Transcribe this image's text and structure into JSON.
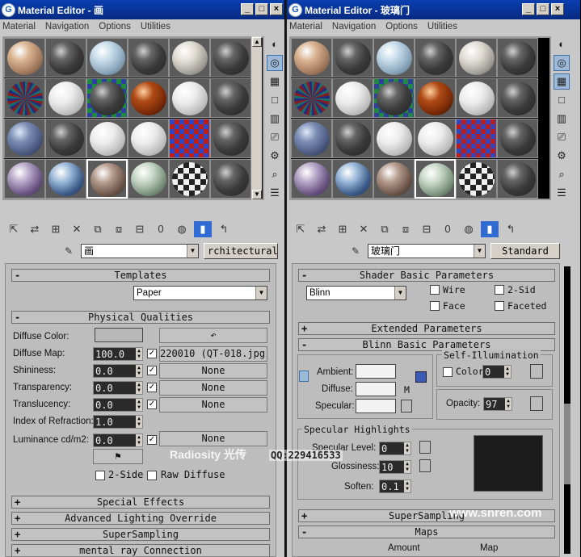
{
  "left_window": {
    "title": "Material Editor - 画",
    "menu": [
      "Material",
      "Navigation",
      "Options",
      "Utilities"
    ],
    "material_name": "画",
    "material_type": "rchitectural",
    "rollouts": {
      "templates": "Templates",
      "template_value": "Paper",
      "physical": "Physical Qualities",
      "special": "Special Effects",
      "advanced": "Advanced Lighting Override",
      "supersampling": "SuperSampling",
      "mentalray": "mental ray Connection"
    },
    "params": [
      {
        "label": "Diffuse Color:",
        "value": "",
        "map": ""
      },
      {
        "label": "Diffuse Map:",
        "value": "100.0",
        "map": "220010 (QT-018.jpg)"
      },
      {
        "label": "Shininess:",
        "value": "0.0",
        "map": "None"
      },
      {
        "label": "Transparency:",
        "value": "0.0",
        "map": "None"
      },
      {
        "label": "Translucency:",
        "value": "0.0",
        "map": "None"
      },
      {
        "label": "Index of Refraction:",
        "value": "1.0",
        "map": ""
      },
      {
        "label": "Luminance cd/m2:",
        "value": "0.0",
        "map": "None"
      }
    ],
    "two_side": "2-Side",
    "raw_diffuse": "Raw Diffuse"
  },
  "right_window": {
    "title": "Material Editor - 玻璃门",
    "menu": [
      "Material",
      "Navigation",
      "Options",
      "Utilities"
    ],
    "material_name": "玻璃门",
    "material_type": "Standard",
    "shader_rollout": "Shader Basic Parameters",
    "shader": "Blinn",
    "shader_opts": {
      "wire": "Wire",
      "two_sided": "2-Sid",
      "face": "Face",
      "faceted": "Faceted"
    },
    "extended": "Extended Parameters",
    "blinn": "Blinn Basic Parameters",
    "self_illum": "Self-Illumination",
    "color_label": "Color",
    "color_value": "0",
    "ambient": "Ambient:",
    "diffuse": "Diffuse:",
    "specular": "Specular:",
    "m_label": "M",
    "opacity_label": "Opacity:",
    "opacity_value": "97",
    "spec_highlights": "Specular Highlights",
    "spec_level_label": "Specular Level:",
    "spec_level": "0",
    "gloss_label": "Glossiness:",
    "gloss": "10",
    "soften_label": "Soften:",
    "soften": "0.1",
    "supersampling": "SuperSampling",
    "maps": "Maps",
    "amount_header": "Amount",
    "map_header": "Map"
  },
  "watermarks": {
    "radiosity": "Radiosity 光传",
    "qq": "QQ:229416533",
    "site": "www.snren.com"
  }
}
